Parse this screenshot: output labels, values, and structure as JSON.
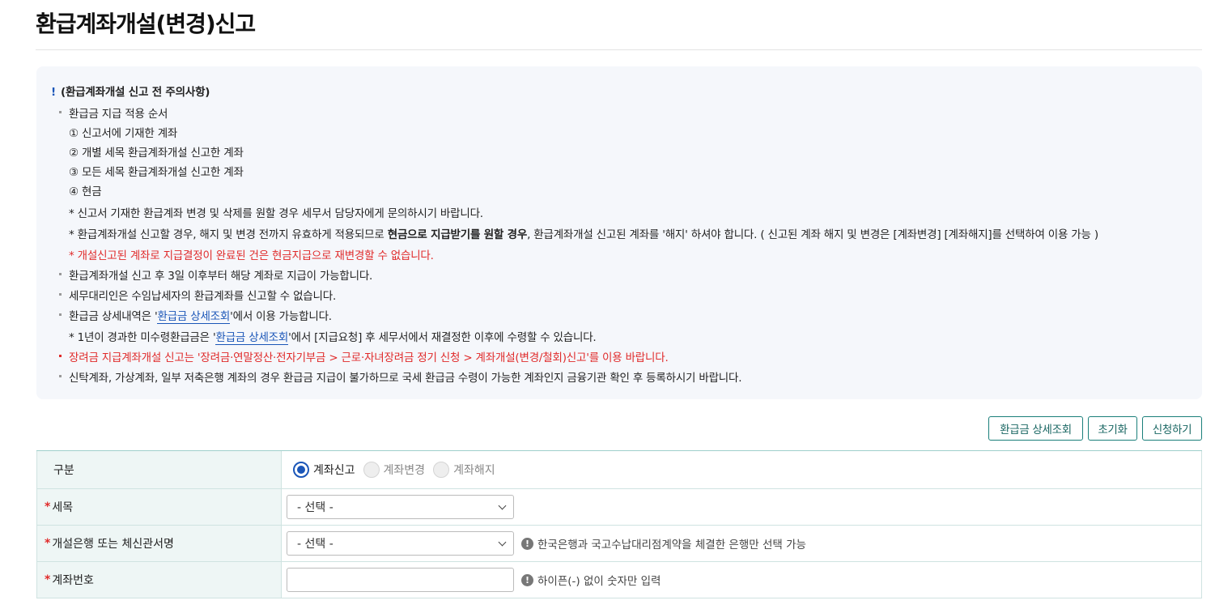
{
  "page": {
    "title": "환급계좌개설(변경)신고"
  },
  "notice": {
    "header": "(환급계좌개설 신고 전 주의사항)",
    "order_title": "환급금 지급 적용 순서",
    "order_items": [
      "① 신고서에 기재한 계좌",
      "② 개별 세목 환급계좌개설 신고한 계좌",
      "③ 모든 세목 환급계좌개설 신고한 계좌",
      "④ 현금"
    ],
    "note1": "* 신고서 기재한 환급계좌 변경 및 삭제를 원할 경우 세무서 담당자에게 문의하시기 바랍니다.",
    "note2_a": "* 환급계좌개설 신고할 경우, 해지 및 변경 전까지 유효하게 적용되므로 ",
    "note2_b": "현금으로 지급받기를 원할 경우",
    "note2_c": ", 환급계좌개설 신고된 계좌를 '해지' 하셔야 합니다. ( 신고된 계좌 해지 및 변경은 [계좌변경] [계좌해지]를 선택하여 이용 가능 )",
    "note3": "* 개설신고된 계좌로 지급결정이 완료된 건은 현금지급으로 재변경할 수 없습니다.",
    "item2": "환급계좌개설 신고 후 3일 이후부터 해당 계좌로 지급이 가능합니다.",
    "item3": "세무대리인은 수임납세자의 환급계좌를 신고할 수 없습니다.",
    "item4_a": "환급금 상세내역은 '",
    "item4_link": "환급금 상세조회",
    "item4_b": "'에서 이용 가능합니다.",
    "item4_sub_a": "* 1년이 경과한 미수령환급금은 '",
    "item4_sub_link": "환급금 상세조회",
    "item4_sub_b": "'에서 [지급요청] 후 세무서에서 재결정한 이후에 수령할 수 있습니다.",
    "item5": "장려금 지급계좌개설 신고는 '장려금·연말정산·전자기부금 > 근로·자녀장려금 정기 신청 > 계좌개설(변경/철회)신고'를 이용 바랍니다.",
    "item6": "신탁계좌, 가상계좌, 일부 저축은행 계좌의 경우 환급금 지급이 불가하므로 국세 환급금 수령이 가능한 계좌인지 금융기관 확인 후 등록하시기 바랍니다."
  },
  "buttons": {
    "detail": "환급금 상세조회",
    "reset": "초기화",
    "apply": "신청하기"
  },
  "form": {
    "type_label": "구분",
    "type_options": [
      "계좌신고",
      "계좌변경",
      "계좌해지"
    ],
    "type_selected": "계좌신고",
    "required_mark": "*",
    "tax_label": "세목",
    "tax_value": "- 선택 -",
    "bank_label": "개설은행 또는 체신관서명",
    "bank_value": "- 선택 -",
    "bank_hint": "한국은행과 국고수납대리점계약을 체결한 은행만 선택 가능",
    "account_label": "계좌번호",
    "account_value": "",
    "account_hint": "하이픈(-) 없이 숫자만 입력",
    "hint_icon": "!"
  },
  "colors": {
    "accent": "#1b56b8",
    "teal": "#1a7f7a",
    "warning": "#e02a2a"
  }
}
